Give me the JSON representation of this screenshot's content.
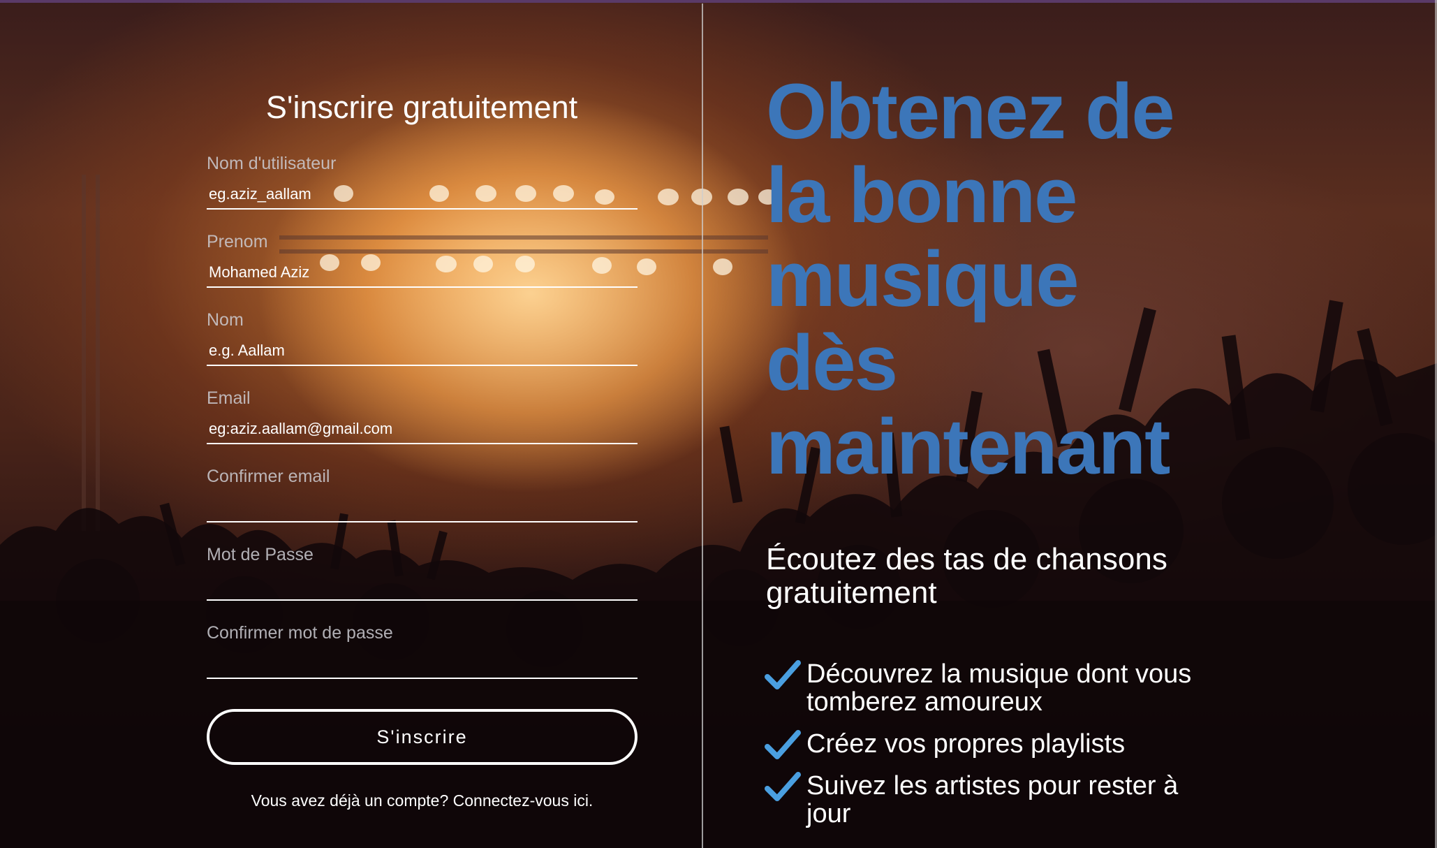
{
  "signup_form": {
    "title": "S'inscrire gratuitement",
    "fields": [
      {
        "label": "Nom d'utilisateur",
        "placeholder": "eg.aziz_aallam"
      },
      {
        "label": "Prenom",
        "placeholder": "Mohamed Aziz"
      },
      {
        "label": "Nom",
        "placeholder": "e.g. Aallam"
      },
      {
        "label": "Email",
        "placeholder": "eg:aziz.aallam@gmail.com"
      },
      {
        "label": "Confirmer email",
        "placeholder": ""
      },
      {
        "label": "Mot de Passe",
        "placeholder": ""
      },
      {
        "label": "Confirmer mot de passe",
        "placeholder": ""
      }
    ],
    "submit_label": "S'inscrire",
    "login_prompt": "Vous avez déjà un compte? Connectez-vous ici."
  },
  "promo": {
    "headline_lines": [
      "Obtenez de",
      "la bonne",
      "musique",
      "dès",
      "maintenant"
    ],
    "subtitle": "Écoutez des tas de chansons gratuitement",
    "features": [
      {
        "text": "Découvrez la musique dont vous tomberez amoureux",
        "icon": "checkmark-icon"
      },
      {
        "text": "Créez vos propres playlists",
        "icon": "checkmark-icon"
      },
      {
        "text": "Suivez les artistes pour rester à jour",
        "icon": "checkmark-icon"
      }
    ]
  },
  "colors": {
    "headline": "#3c76b9",
    "checkmark": "#4a9fe0",
    "text": "#ffffff",
    "label": "#cdcdd2"
  },
  "background": {
    "icon": "concert-crowd-background"
  }
}
